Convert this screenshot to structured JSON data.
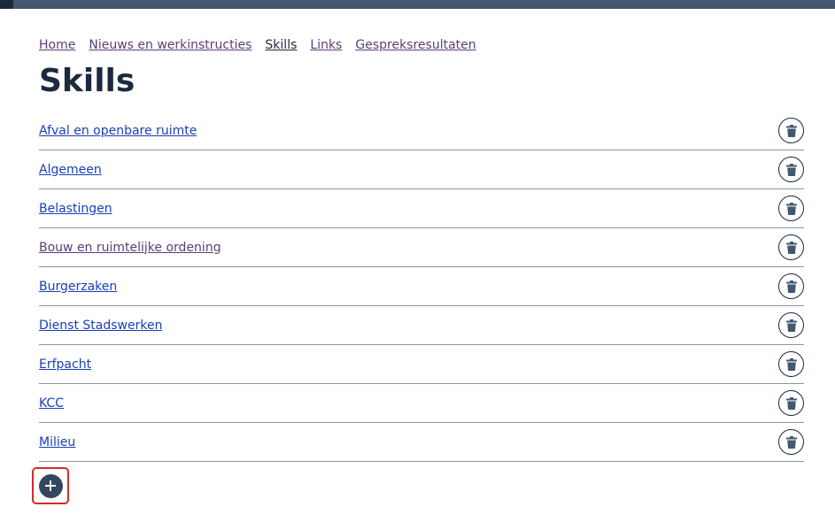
{
  "breadcrumb": [
    {
      "label": "Home",
      "current": false
    },
    {
      "label": "Nieuws en werkinstructies",
      "current": false
    },
    {
      "label": "Skills",
      "current": true
    },
    {
      "label": "Links",
      "current": false
    },
    {
      "label": "Gespreksresultaten",
      "current": false
    }
  ],
  "page": {
    "title": "Skills"
  },
  "skills": [
    {
      "label": "Afval en openbare ruimte",
      "visited": false
    },
    {
      "label": "Algemeen",
      "visited": false
    },
    {
      "label": "Belastingen",
      "visited": false
    },
    {
      "label": "Bouw en ruimtelijke ordening",
      "visited": true
    },
    {
      "label": "Burgerzaken",
      "visited": false
    },
    {
      "label": "Dienst Stadswerken",
      "visited": false
    },
    {
      "label": "Erfpacht",
      "visited": false
    },
    {
      "label": "KCC",
      "visited": false
    },
    {
      "label": "Milieu",
      "visited": false
    }
  ],
  "icons": {
    "delete": "trash-icon",
    "add": "plus-icon"
  },
  "colors": {
    "topbar": "#44576f",
    "title": "#1c2a40",
    "link": "#1a3eb8",
    "visited_link": "#5c3d77",
    "focus_outline": "#d12b2b"
  }
}
